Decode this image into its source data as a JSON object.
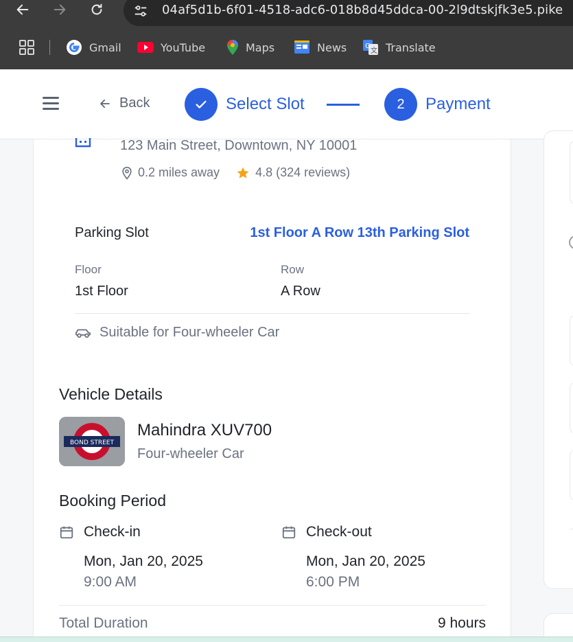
{
  "browser": {
    "url": "04af5d1b-6f01-4518-adc6-018b8d45ddca-00-2l9dtskjfk3e5.pike",
    "bookmarks": [
      {
        "label": "Gmail",
        "icon": "gmail-icon"
      },
      {
        "label": "YouTube",
        "icon": "youtube-icon"
      },
      {
        "label": "Maps",
        "icon": "maps-icon"
      },
      {
        "label": "News",
        "icon": "news-icon"
      },
      {
        "label": "Translate",
        "icon": "translate-icon"
      }
    ]
  },
  "header": {
    "back_label": "Back",
    "steps": [
      {
        "number": "✓",
        "label": "Select Slot",
        "state": "complete"
      },
      {
        "number": "2",
        "label": "Payment",
        "state": "active"
      }
    ]
  },
  "location": {
    "address": "123 Main Street, Downtown, NY 10001",
    "distance": "0.2 miles away",
    "rating": "4.8 (324 reviews)"
  },
  "slot": {
    "label": "Parking Slot",
    "value": "1st Floor A Row 13th Parking Slot",
    "floor_label": "Floor",
    "floor_value": "1st Floor",
    "row_label": "Row",
    "row_value": "A Row",
    "suitability": "Suitable for Four-wheeler Car"
  },
  "vehicle": {
    "section_title": "Vehicle Details",
    "name": "Mahindra XUV700",
    "type": "Four-wheeler Car",
    "image_sign_text": "BOND STREET"
  },
  "booking": {
    "section_title": "Booking Period",
    "checkin_label": "Check-in",
    "checkin_date": "Mon, Jan 20, 2025",
    "checkin_time": "9:00 AM",
    "checkout_label": "Check-out",
    "checkout_date": "Mon, Jan 20, 2025",
    "checkout_time": "6:00 PM",
    "total_label": "Total Duration",
    "total_value": "9 hours"
  },
  "colors": {
    "accent": "#2a5fe0",
    "star": "#f4a316",
    "chrome_bg": "#3c3c3c"
  }
}
